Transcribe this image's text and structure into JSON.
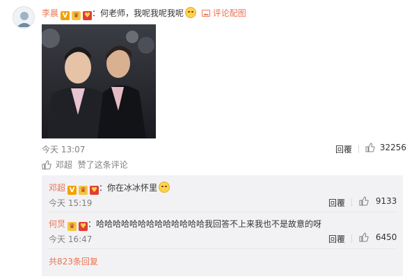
{
  "comment": {
    "author": "李晨",
    "separator": "：",
    "text": "何老师，我呢我呢我呢",
    "image_link": "评论配图",
    "time": "今天 13:07",
    "reply_label": "回覆",
    "like_count": "32256",
    "liker": "邓超",
    "liked_text": "赞了这条评论"
  },
  "replies": [
    {
      "author": "邓超",
      "separator": "：",
      "text": "你在冰冰怀里",
      "time": "今天 15:19",
      "reply_label": "回覆",
      "like_count": "9133"
    },
    {
      "author": "何炅",
      "separator": "：",
      "text": "哈哈哈哈哈哈哈哈哈哈哈哈哈我回答不上来我也不是故意的呀",
      "time": "今天 16:47",
      "reply_label": "回覆",
      "like_count": "6450"
    }
  ],
  "more_replies": "共823条回复",
  "colors": {
    "name": "#eb7350",
    "muted": "#808080",
    "subbox_bg": "#f2f2f5"
  }
}
